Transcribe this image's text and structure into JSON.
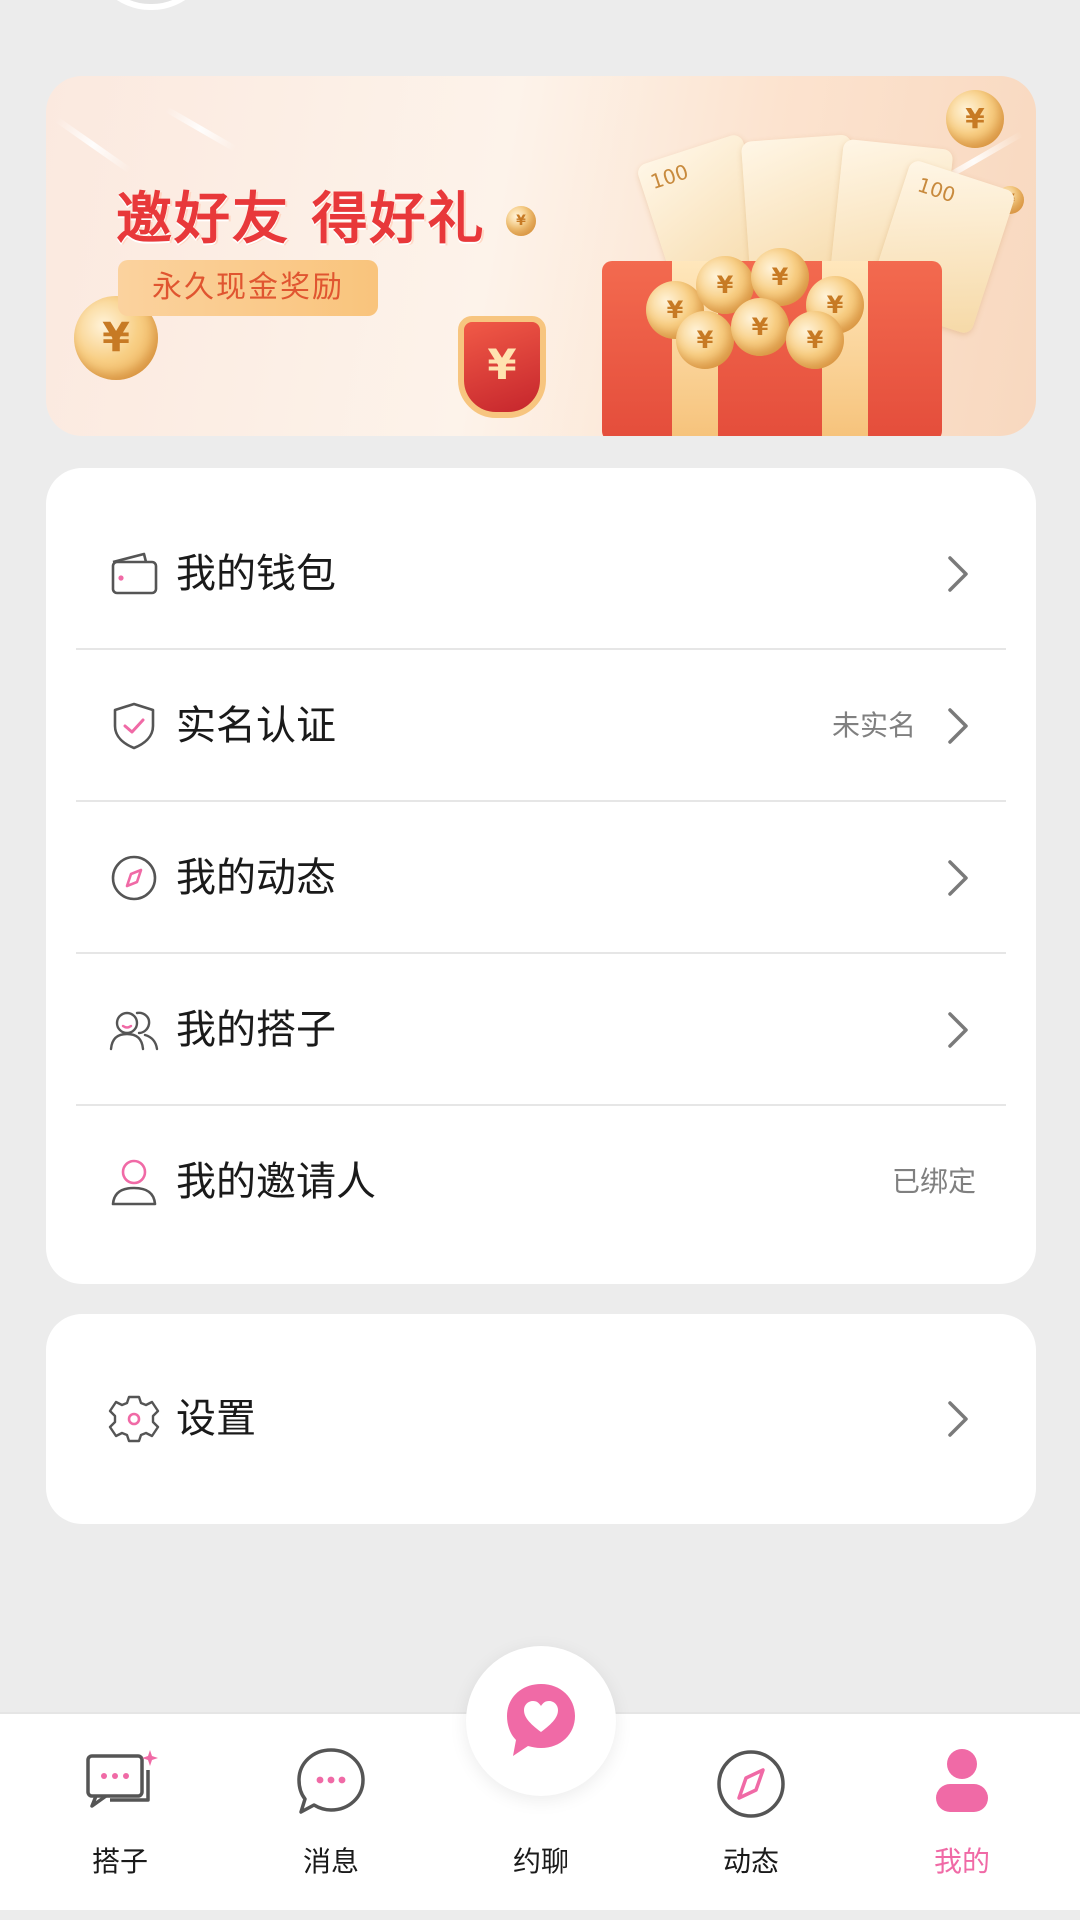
{
  "banner": {
    "title": "邀好友 得好礼",
    "subtitle": "永久现金奖励",
    "card_value": "100",
    "currency_symbol": "¥"
  },
  "menu": {
    "items": [
      {
        "label": "我的钱包",
        "value": "",
        "icon": "wallet-icon",
        "has_chevron": true
      },
      {
        "label": "实名认证",
        "value": "未实名",
        "icon": "shield-check-icon",
        "has_chevron": true
      },
      {
        "label": "我的动态",
        "value": "",
        "icon": "compass-icon",
        "has_chevron": true
      },
      {
        "label": "我的搭子",
        "value": "",
        "icon": "people-icon",
        "has_chevron": true
      },
      {
        "label": "我的邀请人",
        "value": "已绑定",
        "icon": "person-icon",
        "has_chevron": false
      }
    ]
  },
  "settings": {
    "label": "设置",
    "icon": "gear-icon"
  },
  "bottom_nav": {
    "items": [
      {
        "label": "搭子",
        "icon": "partner-chat-icon",
        "active": false
      },
      {
        "label": "消息",
        "icon": "message-bubble-icon",
        "active": false
      },
      {
        "label": "约聊",
        "icon": "heart-chat-icon",
        "active": false
      },
      {
        "label": "动态",
        "icon": "compass-icon",
        "active": false
      },
      {
        "label": "我的",
        "icon": "profile-icon",
        "active": true
      }
    ]
  },
  "colors": {
    "accent_pink": "#f06aa6",
    "background": "#ececec",
    "banner_title_red": "#e8383a"
  }
}
